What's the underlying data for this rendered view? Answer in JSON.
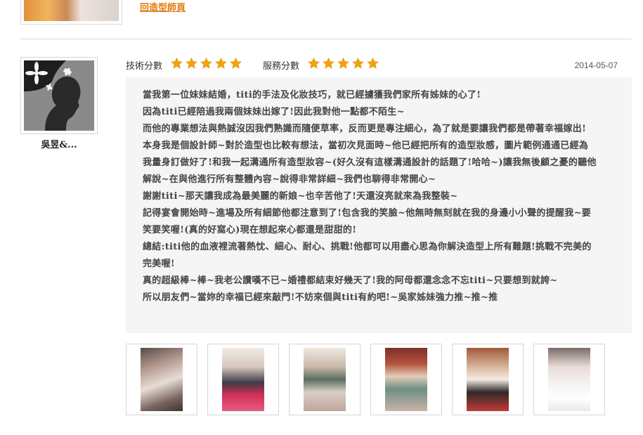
{
  "previous": {
    "back_link": "回造型師頁"
  },
  "review": {
    "username": "吳昱&...",
    "technique_label": "技術分數",
    "service_label": "服務分數",
    "technique_stars": 5,
    "service_stars": 5,
    "date": "2014-05-07",
    "lines": [
      "當我第一位妹妹結婚，titi的手法及化妝技巧，就已經擄獲我們家所有姊妹的心了!",
      "因為titi已經陪過我兩個妹妹出嫁了!因此我對他一點都不陌生~",
      "而他的專業想法與熱誠沒因我們熟識而隨便草率，反而更是專注細心，為了就是要讓我們都是帶著幸福嫁出!",
      "本身我是個設計師~對於造型也比較有想法，當初次見面時~他已經把所有的造型妝感，圖片範例通通已經為",
      "我量身訂做好了!和我一起溝通所有造型妝容~(好久沒有這樣溝通設計的話題了!哈哈~)讓我無後顧之憂的聽他",
      "解說~在與他進行所有整體內容~說得非常詳細~我們也聊得非常開心~",
      "謝謝titi~那天讓我成為最美麗的新娘~也辛苦他了!天還沒亮就來為我整裝~",
      "記得宴會開始時~進場及所有細節他都注意到了!包含我的笑臉~他無時無刻就在我的身邊小小聲的提醒我~要",
      "笑要笑喔!(真的好窩心)現在想起來心都還是甜甜的!",
      "總結:titi他的血液裡流著熱忱、細心、耐心、挑戰!他都可以用盡心思為你解決造型上所有難題!挑戰不完美的",
      "完美喔!",
      "真的超級棒~棒~我老公讚嘆不已~婚禮都結束好幾天了!我的阿母都還念念不忘titi~只要想到就誇~",
      "所以朋友們~當妳的幸福已經來敲門!不妨來個與titi有約吧!~吳家姊妹強力推~推~推"
    ]
  },
  "colors": {
    "star": "#f2a20c",
    "link": "#e07a10",
    "review_bg": "#f5f5f5"
  },
  "icons": {
    "star": "star-icon",
    "avatar": "avatar-silhouette-icon"
  }
}
